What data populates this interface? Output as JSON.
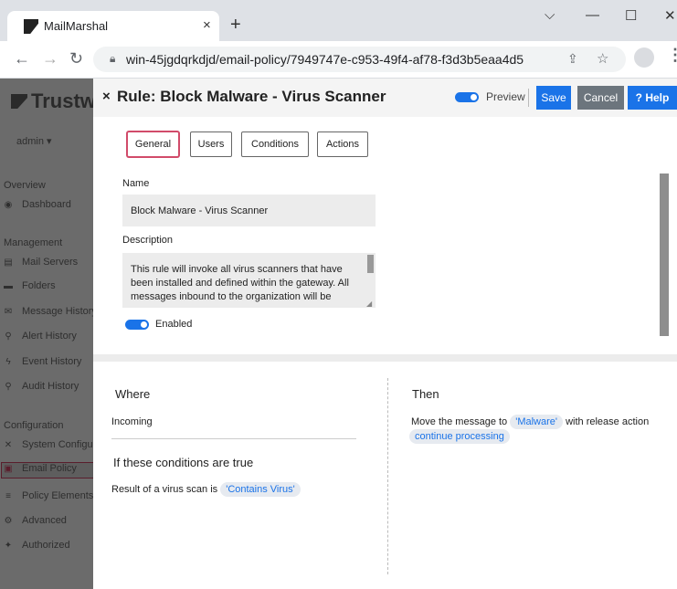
{
  "browser": {
    "tab_title": "MailMarshal",
    "tab_close": "×",
    "new_tab": "+",
    "url": "win-45jgdqrkdjd/email-policy/7949747e-c953-49f4-af78-f3d3b5eaa4d5",
    "window_controls": {
      "minimize": "—",
      "maximize": "☐",
      "close": "✕",
      "dropdown": "⌵"
    },
    "nav": {
      "back": "←",
      "forward": "→",
      "reload": "↻"
    }
  },
  "sidebar": {
    "brand": "Trustwave",
    "user": "admin ▾",
    "sections": [
      {
        "title": "Overview",
        "items": [
          {
            "label": "Dashboard",
            "icon": "dashboard-icon",
            "glyph": "◉"
          }
        ]
      },
      {
        "title": "Management",
        "items": [
          {
            "label": "Mail Servers",
            "icon": "server-icon",
            "glyph": "▤"
          },
          {
            "label": "Folders",
            "icon": "folder-icon",
            "glyph": "▬"
          },
          {
            "label": "Message History",
            "icon": "message-icon",
            "glyph": "✉"
          },
          {
            "label": "Alert History",
            "icon": "search-icon",
            "glyph": "⚲"
          },
          {
            "label": "Event History",
            "icon": "bolt-icon",
            "glyph": "ϟ"
          },
          {
            "label": "Audit History",
            "icon": "search-icon",
            "glyph": "⚲"
          }
        ]
      },
      {
        "title": "Configuration",
        "items": [
          {
            "label": "System Configuration",
            "icon": "tools-icon",
            "glyph": "✕"
          },
          {
            "label": "Email Policy",
            "icon": "policy-icon",
            "glyph": "▣"
          },
          {
            "label": "Policy Elements",
            "icon": "database-icon",
            "glyph": "≡"
          },
          {
            "label": "Advanced",
            "icon": "cogs-icon",
            "glyph": "⚙"
          },
          {
            "label": "Authorized",
            "icon": "users-icon",
            "glyph": "✦"
          }
        ]
      }
    ]
  },
  "header": {
    "title": "Rule: Block Malware - Virus Scanner",
    "preview_label": "Preview",
    "save_label": "Save",
    "cancel_label": "Cancel",
    "help_label": "? Help"
  },
  "tabs": [
    "General",
    "Users",
    "Conditions",
    "Actions"
  ],
  "form": {
    "name_label": "Name",
    "name_value": "Block Malware - Virus Scanner",
    "description_label": "Description",
    "description_value": "This rule will invoke all virus scanners that have been installed and defined within the gateway.  All messages inbound to the organization will be",
    "enabled_label": "Enabled"
  },
  "where": {
    "heading": "Where",
    "value": "Incoming",
    "conditions_heading": "If these conditions are true",
    "condition_text": "Result of a virus scan is",
    "condition_value": "'Contains Virus'"
  },
  "then": {
    "heading": "Then",
    "action_prefix": "Move the message to",
    "folder": "'Malware'",
    "action_middle": "with release action",
    "release_action": "continue processing"
  }
}
